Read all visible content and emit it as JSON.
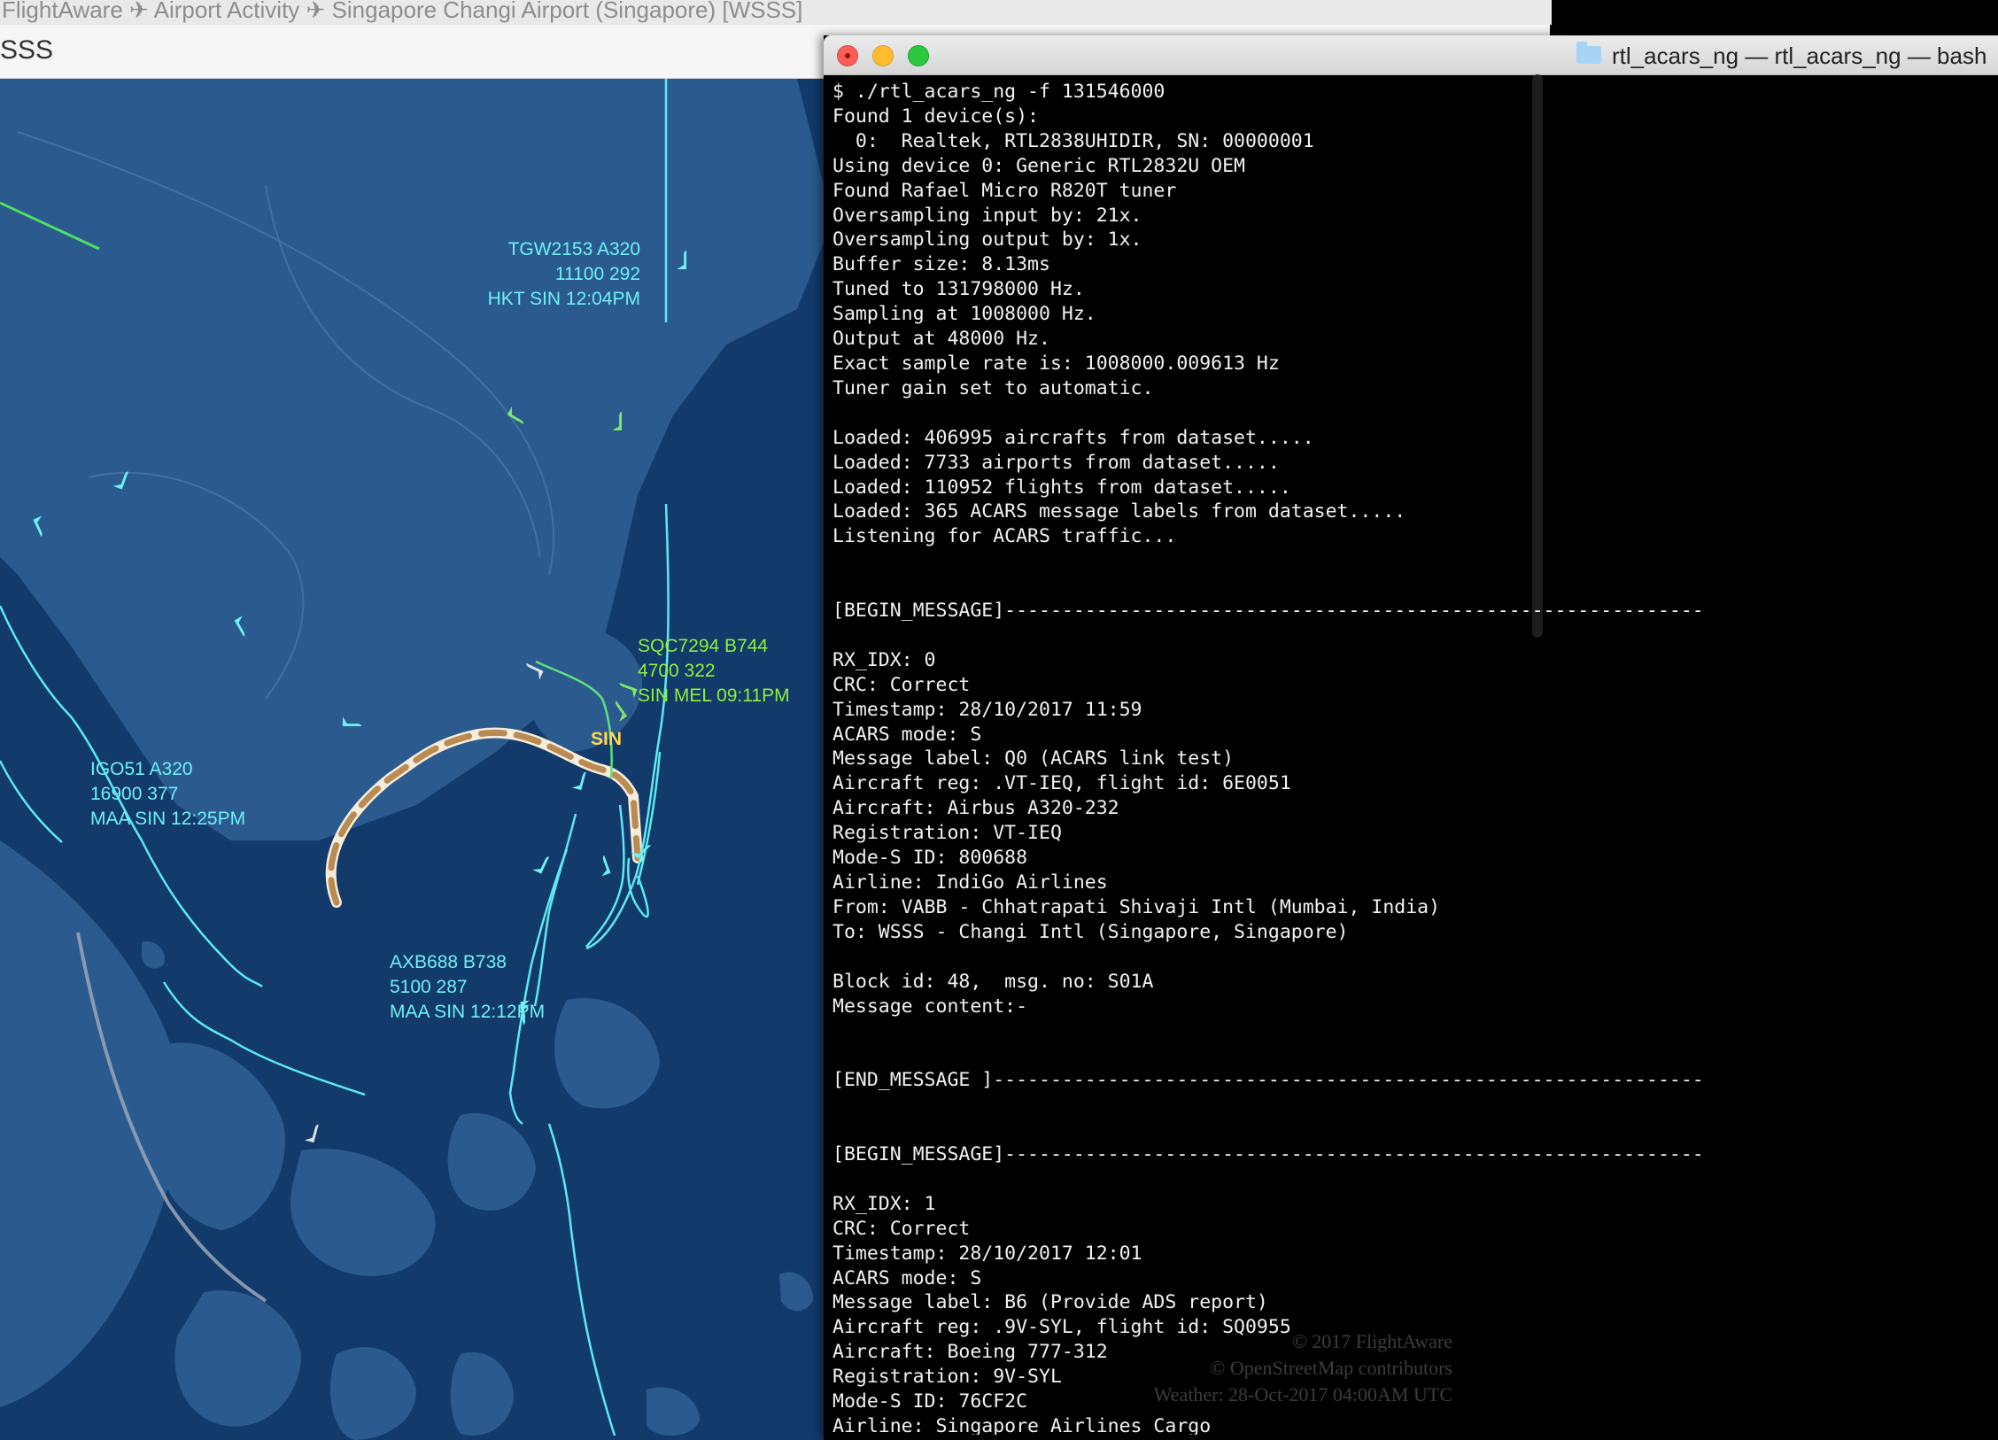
{
  "browser": {
    "title": "FlightAware ✈ Airport Activity ✈ Singapore Changi Airport (Singapore) [WSSS]",
    "url_fragment": "SSS"
  },
  "map": {
    "colors": {
      "water": "#123a6b",
      "land": "#2b5a8e",
      "flight_cyan": "#6ff0f4",
      "flight_green": "#8cf03c",
      "airport_label": "#ffd84a"
    },
    "airport_label": "SIN",
    "flights": [
      {
        "line1": "TGW2153 A320",
        "line2": "11100 292",
        "line3": "HKT SIN 12:04PM",
        "color": "cyan"
      },
      {
        "line1": "SQC7294 B744",
        "line2": "4700 322",
        "line3": "SIN MEL 09:11PM",
        "color": "green"
      },
      {
        "line1": "IGO51 A320",
        "line2": "16900 377",
        "line3": "MAA SIN 12:25PM",
        "color": "cyan"
      },
      {
        "line1": "AXB688 B738",
        "line2": "5100 287",
        "line3": "MAA SIN 12:12PM",
        "color": "cyan"
      }
    ],
    "icons": [
      "airplane-icon"
    ]
  },
  "terminal": {
    "title": "rtl_acars_ng — rtl_acars_ng — bash",
    "watermark": {
      "line1": "© 2017 FlightAware",
      "line2": "© OpenStreetMap contributors",
      "line3": "Weather: 28-Oct-2017 04:00AM UTC"
    },
    "lines": [
      "$ ./rtl_acars_ng -f 131546000",
      "Found 1 device(s):",
      "  0:  Realtek, RTL2838UHIDIR, SN: 00000001",
      "Using device 0: Generic RTL2832U OEM",
      "Found Rafael Micro R820T tuner",
      "Oversampling input by: 21x.",
      "Oversampling output by: 1x.",
      "Buffer size: 8.13ms",
      "Tuned to 131798000 Hz.",
      "Sampling at 1008000 Hz.",
      "Output at 48000 Hz.",
      "Exact sample rate is: 1008000.009613 Hz",
      "Tuner gain set to automatic.",
      "",
      "Loaded: 406995 aircrafts from dataset.....",
      "Loaded: 7733 airports from dataset.....",
      "Loaded: 110952 flights from dataset.....",
      "Loaded: 365 ACARS message labels from dataset.....",
      "Listening for ACARS traffic...",
      "",
      "",
      "[BEGIN_MESSAGE]-------------------------------------------------------------",
      "",
      "RX_IDX: 0",
      "CRC: Correct",
      "Timestamp: 28/10/2017 11:59",
      "ACARS mode: S",
      "Message label: Q0 (ACARS link test)",
      "Aircraft reg: .VT-IEQ, flight id: 6E0051",
      "Aircraft: Airbus A320-232",
      "Registration: VT-IEQ",
      "Mode-S ID: 800688",
      "Airline: IndiGo Airlines",
      "From: VABB - Chhatrapati Shivaji Intl (Mumbai, India)",
      "To: WSSS - Changi Intl (Singapore, Singapore)",
      "",
      "Block id: 48,  msg. no: S01A",
      "Message content:-",
      "",
      "",
      "[END_MESSAGE ]--------------------------------------------------------------",
      "",
      "",
      "[BEGIN_MESSAGE]-------------------------------------------------------------",
      "",
      "RX_IDX: 1",
      "CRC: Correct",
      "Timestamp: 28/10/2017 12:01",
      "ACARS mode: S",
      "Message label: B6 (Provide ADS report)",
      "Aircraft reg: .9V-SYL, flight id: SQ0955",
      "Aircraft: Boeing 777-312",
      "Registration: 9V-SYL",
      "Mode-S ID: 76CF2C",
      "Airline: Singapore Airlines Cargo"
    ]
  }
}
